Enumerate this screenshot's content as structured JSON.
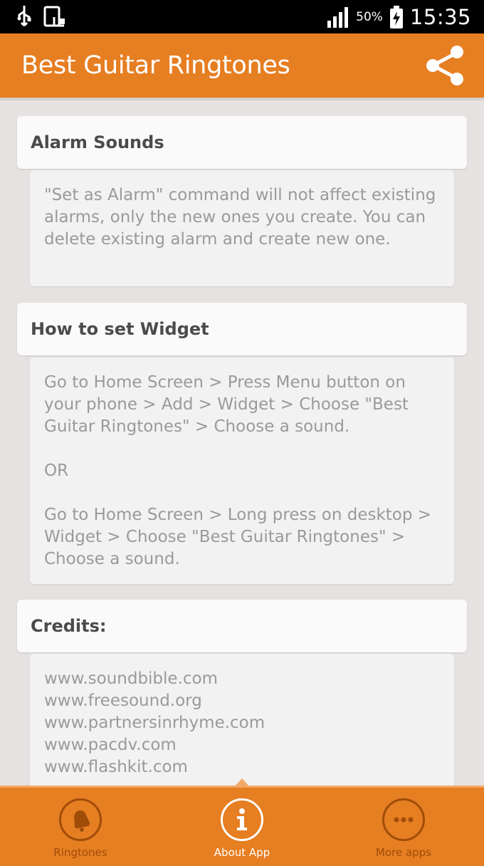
{
  "status_bar": {
    "battery_percent": "50%",
    "time": "15:35"
  },
  "app_bar": {
    "title": "Best Guitar Ringtones",
    "share_icon": "share-icon"
  },
  "sections": [
    {
      "title": "Alarm Sounds",
      "paragraphs": [
        "\"Set as Alarm\" command will not affect existing alarms, only the new ones you create. You can delete existing alarm and create new one."
      ]
    },
    {
      "title": "How to set Widget",
      "paragraphs": [
        "Go to Home Screen > Press Menu button on your phone > Add > Widget > Choose \"Best Guitar Ringtones\" > Choose a sound.",
        "OR",
        "Go to Home Screen > Long press on desktop > Widget > Choose \"Best Guitar Ringtones\" > Choose a sound."
      ]
    },
    {
      "title": "Credits:",
      "links": [
        "www.soundbible.com",
        "www.freesound.org",
        "www.partnersinrhyme.com",
        "www.pacdv.com",
        "www.flashkit.com"
      ]
    }
  ],
  "bottom_nav": {
    "items": [
      {
        "label": "Ringtones",
        "icon": "bell-icon",
        "active": false
      },
      {
        "label": "About App",
        "icon": "info-icon",
        "active": true
      },
      {
        "label": "More apps",
        "icon": "more-icon",
        "active": false
      }
    ]
  },
  "colors": {
    "accent": "#e67e22",
    "background": "#e6e2e1"
  }
}
